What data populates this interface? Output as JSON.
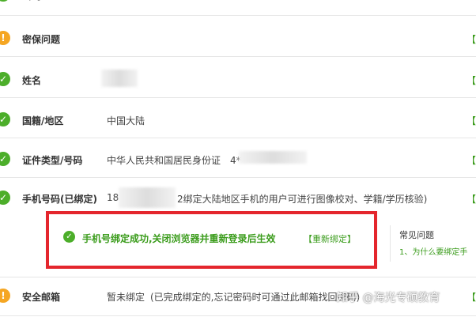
{
  "rows": [
    {
      "label": "密码",
      "status": "ok",
      "value": "",
      "action": ""
    },
    {
      "label": "密保问题",
      "status": "warn",
      "value": "",
      "action": "【设"
    },
    {
      "label": "姓名",
      "status": "ok",
      "value": "",
      "action": "【修"
    },
    {
      "label": "国籍/地区",
      "status": "ok",
      "value": "中国大陆",
      "action": "【修"
    },
    {
      "label": "证件类型/号码",
      "status": "ok",
      "value": "中华人民共和国居民身份证　4*",
      "action": "【修"
    },
    {
      "label": "手机号码(已绑定)",
      "status": "ok",
      "value": "18",
      "value_tail": "2绑定大陆地区手机的用户可进行图像校对、学籍/学历核验)",
      "action": "【收"
    },
    {
      "label": "安全邮箱",
      "status": "warn",
      "value": "暂未绑定",
      "value_tail": "(已完成绑定的,忘记密码时可通过此邮箱找回密码)",
      "action": "【修"
    }
  ],
  "notice": {
    "message": "手机号绑定成功,关闭浏览器并重新登录后生效",
    "link": "【重新绑定】"
  },
  "faq": {
    "title": "常见问题",
    "item1": "1、为什么要绑定手"
  },
  "watermark": "知乎 @海光专硕教育",
  "colors": {
    "green": "#3b9c1c",
    "warn": "#f5a623",
    "highlight": "#e4262d"
  }
}
